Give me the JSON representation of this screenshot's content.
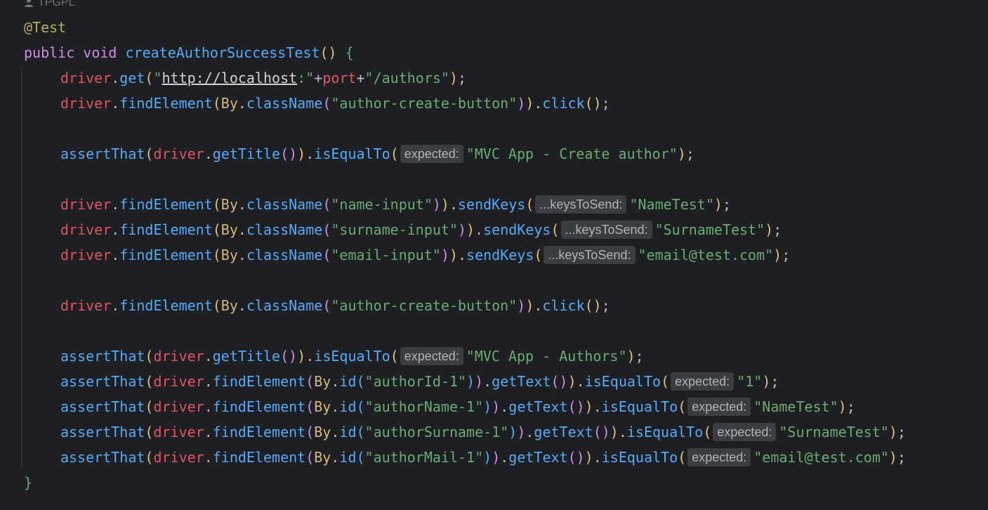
{
  "header": {
    "author": "TPGPL"
  },
  "code": {
    "annotation": "@Test",
    "signature": {
      "modifier": "public",
      "ret": "void",
      "method": "createAuthorSuccessTest"
    },
    "driver": "driver",
    "by": "By",
    "get": "get",
    "find": "findElement",
    "className": "className",
    "id": "id",
    "click": "click",
    "sendKeys": "sendKeys",
    "assertThat": "assertThat",
    "getTitle": "getTitle",
    "getText": "getText",
    "isEqualTo": "isEqualTo",
    "port": "port",
    "url": "http://localhost",
    "url_colon": ":",
    "path": "/authors",
    "hints": {
      "expected": "expected:",
      "keys": "...keysToSend:"
    },
    "strings": {
      "create_btn": "author-create-button",
      "title_create": "MVC App - Create author",
      "name_input": "name-input",
      "surname_input": "surname-input",
      "email_input": "email-input",
      "name_val": "NameTest",
      "surname_val": "SurnameTest",
      "email_val": "email@test.com",
      "title_authors": "MVC App - Authors",
      "id1": "authorId-1",
      "idval": "1",
      "name1": "authorName-1",
      "surname1": "authorSurname-1",
      "mail1": "authorMail-1"
    }
  }
}
